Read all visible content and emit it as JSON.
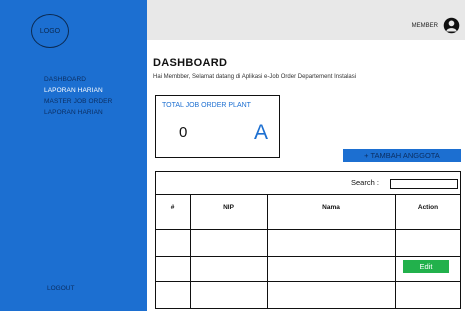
{
  "sidebar": {
    "logo_text": "LOGO",
    "items": [
      {
        "label": "DASHBOARD"
      },
      {
        "label": "LAPORAN HARIAN"
      },
      {
        "label": "MASTER JOB ORDER"
      },
      {
        "label": "LAPORAN HARIAN"
      }
    ],
    "active_item": "LAPORAN HARIAN",
    "logout_label": "LOGOUT"
  },
  "topbar": {
    "member_label": "MEMBER",
    "user_icon": "user-icon"
  },
  "main": {
    "title": "DASHBOARD",
    "welcome_text": "Hai Membber, Selamat datang di Aplikasi e-Job Order Departement Instalasi",
    "card": {
      "label": "TOTAL JOB ORDER PLANT",
      "value": "0",
      "letter": "A"
    },
    "add_button_label": "+ TAMBAH ANGGOTA",
    "table": {
      "search_label": "Search :",
      "search_value": "",
      "headers": [
        "#",
        "NIP",
        "Nama",
        "Action"
      ],
      "row_action_label": "Edit"
    }
  },
  "colors": {
    "sidebar": "#1c6fd1",
    "topbar": "#e8e8e8",
    "accent": "#1c6fd1",
    "edit_button": "#22b14c"
  }
}
